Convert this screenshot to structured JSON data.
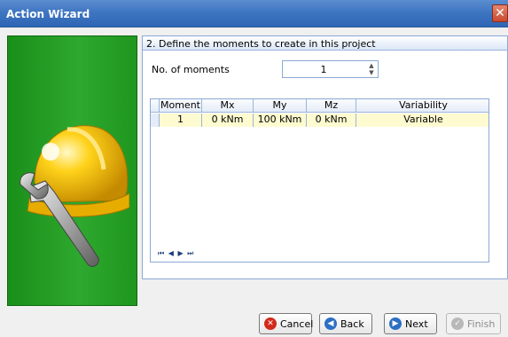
{
  "window": {
    "title": "Action Wizard",
    "close_glyph": "✕"
  },
  "step": {
    "title": "2. Define the moments to create in this project"
  },
  "moments": {
    "label": "No. of moments",
    "value": "1"
  },
  "grid": {
    "headers": [
      "Moment",
      "Mx",
      "My",
      "Mz",
      "Variability"
    ],
    "rows": [
      {
        "moment": "1",
        "mx": "0 kNm",
        "my": "100 kNm",
        "mz": "0 kNm",
        "variability": "Variable"
      }
    ],
    "nav_glyphs": "⏮ ◀ ▶ ⏭"
  },
  "buttons": {
    "cancel": "Cancel",
    "back": "Back",
    "next": "Next",
    "finish": "Finish"
  },
  "icons": {
    "cancel": "cancel-icon",
    "back": "back-arrow-icon",
    "next": "next-arrow-icon",
    "finish": "finish-icon",
    "helmet": "hard-hat-icon",
    "wrench": "wrench-icon"
  },
  "colors": {
    "title_bar": "#3f76c2",
    "side_panel": "#2ea82e",
    "selected_row": "#fffbd0",
    "border": "#8aa9d6"
  }
}
